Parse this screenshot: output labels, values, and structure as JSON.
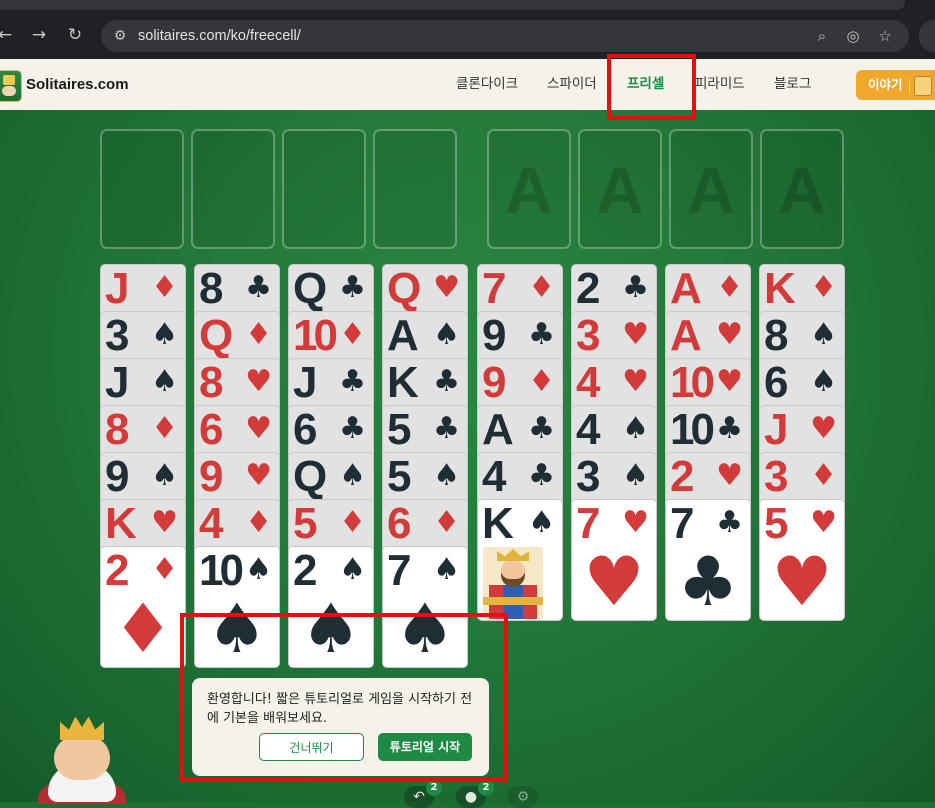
{
  "browser": {
    "url": "solitaires.com/ko/freecell/",
    "back_icon": "←",
    "forward_icon": "→",
    "reload_icon": "↻",
    "tune_icon": "⚙",
    "zoom_icon": "⌕",
    "eye_icon": "◎",
    "star_icon": "☆"
  },
  "header": {
    "site_name": "Solitaires.com",
    "nav": [
      "클론다이크",
      "스파이더",
      "프리셀",
      "피라미드",
      "블로그"
    ],
    "active_nav": "프리셀",
    "story_button": "이야기"
  },
  "colors": {
    "felt": "#237a3a",
    "accent": "#1f8a44",
    "story": "#f0a72c",
    "highlight": "#e31010"
  },
  "game": {
    "freecells": 4,
    "foundation_placeholder": "A",
    "columns": [
      [
        {
          "rank": "J",
          "suit": "♦"
        },
        {
          "rank": "3",
          "suit": "♠"
        },
        {
          "rank": "J",
          "suit": "♠"
        },
        {
          "rank": "8",
          "suit": "♦"
        },
        {
          "rank": "9",
          "suit": "♠"
        },
        {
          "rank": "K",
          "suit": "♥"
        },
        {
          "rank": "2",
          "suit": "♦"
        }
      ],
      [
        {
          "rank": "8",
          "suit": "♣"
        },
        {
          "rank": "Q",
          "suit": "♦"
        },
        {
          "rank": "8",
          "suit": "♥"
        },
        {
          "rank": "6",
          "suit": "♥"
        },
        {
          "rank": "9",
          "suit": "♥"
        },
        {
          "rank": "4",
          "suit": "♦"
        },
        {
          "rank": "10",
          "suit": "♠"
        }
      ],
      [
        {
          "rank": "Q",
          "suit": "♣"
        },
        {
          "rank": "10",
          "suit": "♦"
        },
        {
          "rank": "J",
          "suit": "♣"
        },
        {
          "rank": "6",
          "suit": "♣"
        },
        {
          "rank": "Q",
          "suit": "♠"
        },
        {
          "rank": "5",
          "suit": "♦"
        },
        {
          "rank": "2",
          "suit": "♠"
        }
      ],
      [
        {
          "rank": "Q",
          "suit": "♥"
        },
        {
          "rank": "A",
          "suit": "♠"
        },
        {
          "rank": "K",
          "suit": "♣"
        },
        {
          "rank": "5",
          "suit": "♣"
        },
        {
          "rank": "5",
          "suit": "♠"
        },
        {
          "rank": "6",
          "suit": "♦"
        },
        {
          "rank": "7",
          "suit": "♠"
        }
      ],
      [
        {
          "rank": "7",
          "suit": "♦"
        },
        {
          "rank": "9",
          "suit": "♣"
        },
        {
          "rank": "9",
          "suit": "♦"
        },
        {
          "rank": "A",
          "suit": "♣"
        },
        {
          "rank": "4",
          "suit": "♣"
        },
        {
          "rank": "K",
          "suit": "♠",
          "face": true
        }
      ],
      [
        {
          "rank": "2",
          "suit": "♣"
        },
        {
          "rank": "3",
          "suit": "♥"
        },
        {
          "rank": "4",
          "suit": "♥"
        },
        {
          "rank": "4",
          "suit": "♠"
        },
        {
          "rank": "3",
          "suit": "♠"
        },
        {
          "rank": "7",
          "suit": "♥"
        }
      ],
      [
        {
          "rank": "A",
          "suit": "♦"
        },
        {
          "rank": "A",
          "suit": "♥"
        },
        {
          "rank": "10",
          "suit": "♥"
        },
        {
          "rank": "10",
          "suit": "♣"
        },
        {
          "rank": "2",
          "suit": "♥"
        },
        {
          "rank": "7",
          "suit": "♣"
        }
      ],
      [
        {
          "rank": "K",
          "suit": "♦"
        },
        {
          "rank": "8",
          "suit": "♠"
        },
        {
          "rank": "6",
          "suit": "♠"
        },
        {
          "rank": "J",
          "suit": "♥"
        },
        {
          "rank": "3",
          "suit": "♦"
        },
        {
          "rank": "5",
          "suit": "♥"
        }
      ]
    ]
  },
  "tutorial": {
    "message": "환영합니다! 짧은 튜토리얼로 게임을 시작하기 전에 기본을 배워보세요.",
    "skip_label": "건너뛰기",
    "start_label": "튜토리얼 시작"
  },
  "controls": [
    {
      "icon": "undo-icon",
      "badge": "2"
    },
    {
      "icon": "hint-icon",
      "badge": "2"
    }
  ]
}
